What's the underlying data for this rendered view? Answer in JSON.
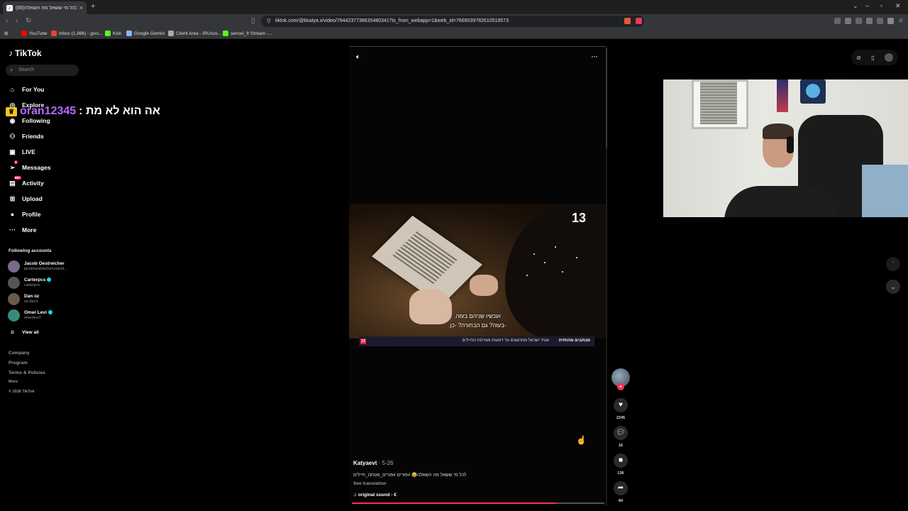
{
  "browser": {
    "tab_title": "לכל מי ששאל מה השאלה(66) !",
    "url": "tiktok.com/@kkatya.x/video/7644237738635480341?is_from_webapp=1&web_id=7669039782610519573",
    "bookmarks": [
      {
        "label": "YouTube",
        "color": "#ff0000"
      },
      {
        "label": "Inbox (1,986) - givo...",
        "color": "#ea4335"
      },
      {
        "label": "Kick",
        "color": "#53fc18"
      },
      {
        "label": "Google Gemini",
        "color": "#8ab4f8"
      },
      {
        "label": "Client Area - IRUsos...",
        "color": "#aaaaaa"
      },
      {
        "label": "sensei_fr Stream -...",
        "color": "#53fc18"
      }
    ]
  },
  "sidebar": {
    "logo": "TikTok",
    "search_placeholder": "Search",
    "nav": [
      {
        "label": "For You",
        "icon": "home-icon"
      },
      {
        "label": "Explore",
        "icon": "compass-icon"
      },
      {
        "label": "Following",
        "icon": "following-icon"
      },
      {
        "label": "Friends",
        "icon": "friends-icon"
      },
      {
        "label": "LIVE",
        "icon": "live-icon"
      },
      {
        "label": "Messages",
        "icon": "messages-icon",
        "badge": "1"
      },
      {
        "label": "Activity",
        "icon": "activity-icon",
        "badge": "99+"
      },
      {
        "label": "Upload",
        "icon": "upload-icon"
      },
      {
        "label": "Profile",
        "icon": "profile-icon"
      },
      {
        "label": "More",
        "icon": "more-icon"
      }
    ],
    "following_title": "Following accounts",
    "accounts": [
      {
        "name": "Jacob Oestreicher",
        "handle": "jacoboestreichercoachi...",
        "verified": false
      },
      {
        "name": "Carterpcs",
        "handle": "carterpcs",
        "verified": true
      },
      {
        "name": "Dan oz",
        "handle": "oz.dan1",
        "verified": false
      },
      {
        "name": "Omer Levi",
        "handle": "omerlevi7",
        "verified": true
      }
    ],
    "view_all": "View all",
    "footer": [
      "Company",
      "Program",
      "Terms & Policies",
      "More",
      "© 2026 TikTok"
    ]
  },
  "chat_overlay": {
    "username": "oran12345",
    "message": "אה הוא לא מת :"
  },
  "video": {
    "subtitle_line1": "ועכשיו שניהם בעזה.",
    "subtitle_line2": "-בעזה? גם הבחורה? -כן.",
    "ticker_headline": "מכתבים מהחזית",
    "ticker_body": "אנחי ישראל מתרגשים עד דמעות ממילות החיילים",
    "channel_logo": "13",
    "author": "Katyaevt",
    "date": "· 5-26",
    "caption": "לכל מי ששאל מה השאלה😂 #פורים #פורים_ואנחנו_חיילים",
    "see_translation": "See translation",
    "sound": "original sound - €",
    "progress": 0.81
  },
  "actions": {
    "likes": "2245",
    "comments": "16",
    "saves": "136",
    "shares": "84"
  }
}
